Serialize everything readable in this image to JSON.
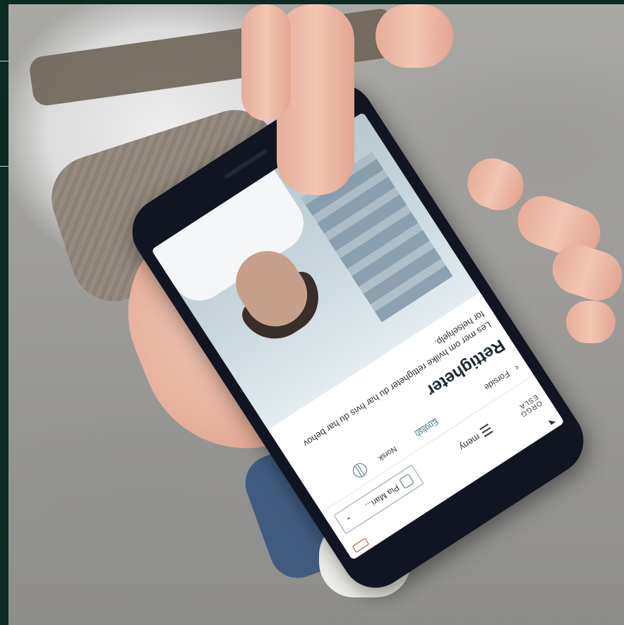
{
  "screen": {
    "status": {
      "wifi_icon": "wifi-icon",
      "battery_icon": "battery-icon"
    },
    "header": {
      "logo_text": "ORGG\nESLA",
      "user_name": "Pia Mari...",
      "user_icon": "id-card-icon",
      "caret_icon": "chevron-down-icon",
      "menu_label": "meny",
      "menu_icon": "hamburger-icon"
    },
    "breadcrumb": {
      "back_icon": "chevron-left-icon",
      "label": "Forside"
    },
    "language": {
      "english": "English",
      "norsk": "Norsk",
      "globe_icon": "globe-icon"
    },
    "page_title": "Rettigheter",
    "lead_text": "Les mer om hvilke rettigheter du har hvis du har behov for helsehjelp."
  }
}
